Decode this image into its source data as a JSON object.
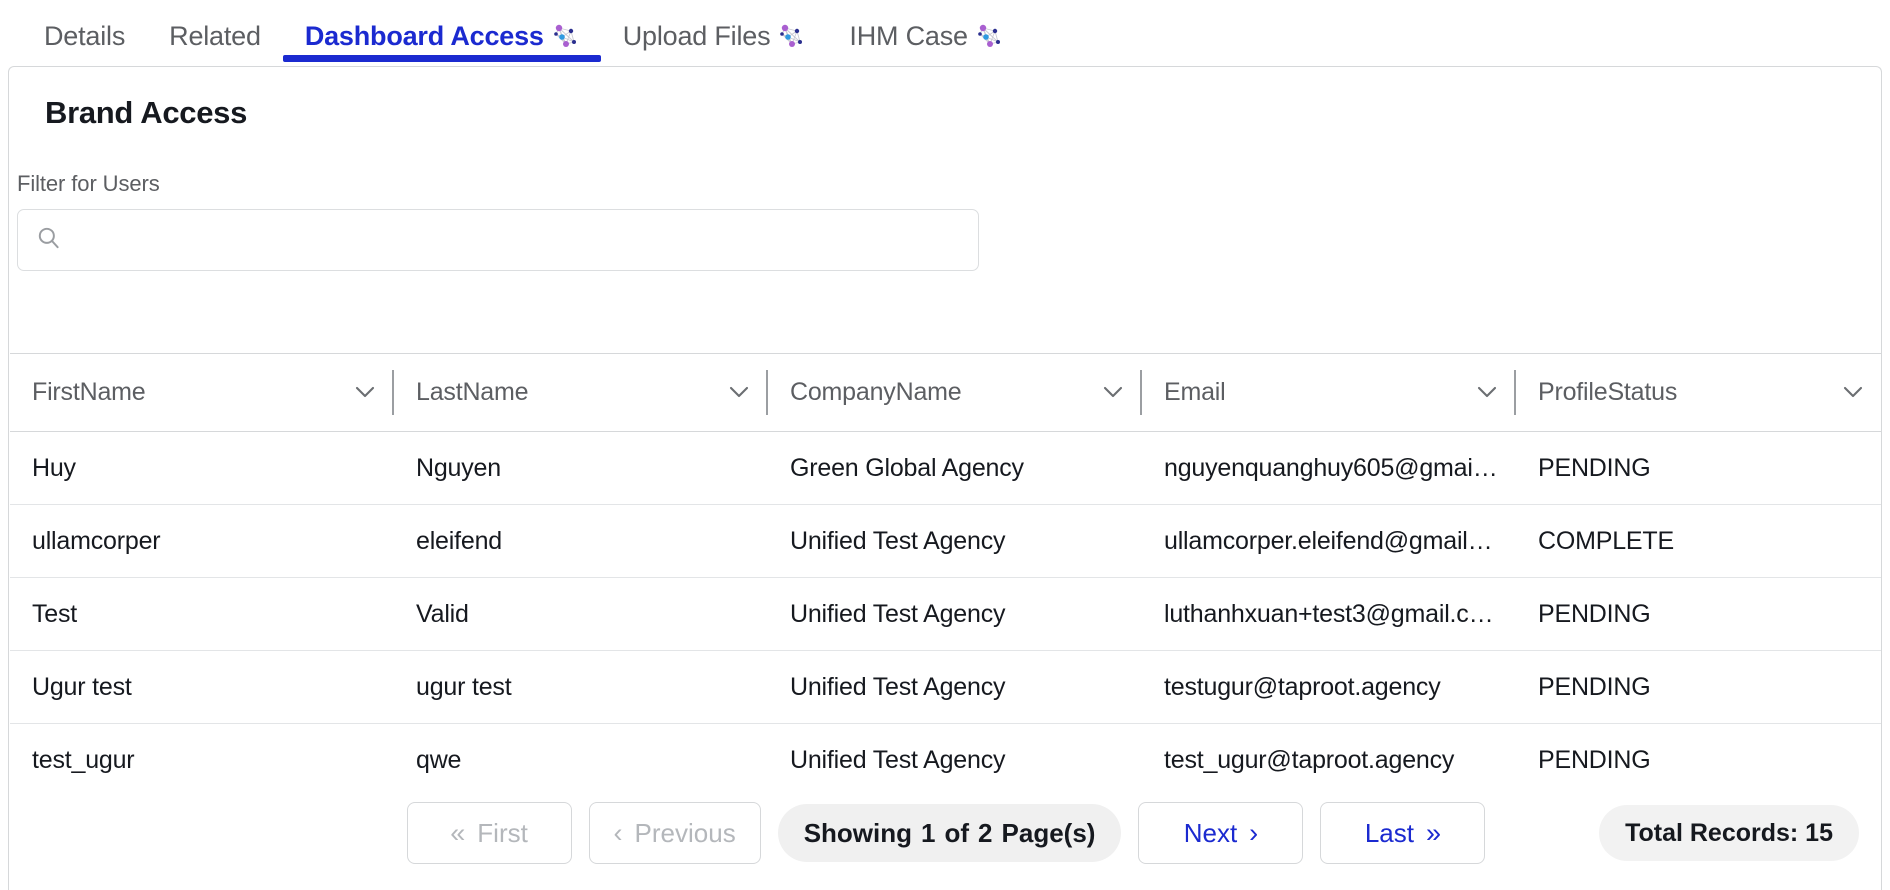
{
  "tabs": [
    {
      "label": "Details",
      "active": false,
      "icon": null
    },
    {
      "label": "Related",
      "active": false,
      "icon": null
    },
    {
      "label": "Dashboard Access",
      "active": true,
      "icon": "network-graph-icon"
    },
    {
      "label": "Upload Files",
      "active": false,
      "icon": "network-graph-icon"
    },
    {
      "label": "IHM Case",
      "active": false,
      "icon": "network-graph-icon"
    }
  ],
  "card": {
    "title": "Brand Access",
    "filter_label": "Filter for Users",
    "search": {
      "value": "",
      "placeholder": "",
      "icon": "search-icon"
    }
  },
  "table": {
    "columns": [
      {
        "label": "FirstName",
        "icon": "chevron-down-icon"
      },
      {
        "label": "LastName",
        "icon": "chevron-down-icon"
      },
      {
        "label": "CompanyName",
        "icon": "chevron-down-icon"
      },
      {
        "label": "Email",
        "icon": "chevron-down-icon"
      },
      {
        "label": "ProfileStatus",
        "icon": "chevron-down-icon"
      }
    ],
    "rows": [
      {
        "FirstName": "Huy",
        "LastName": "Nguyen",
        "CompanyName": "Green Global Agency",
        "Email": "nguyenquanghuy605@gmai…",
        "ProfileStatus": "PENDING"
      },
      {
        "FirstName": "ullamcorper",
        "LastName": "eleifend",
        "CompanyName": "Unified Test Agency",
        "Email": "ullamcorper.eleifend@gmail…",
        "ProfileStatus": "COMPLETE"
      },
      {
        "FirstName": "Test",
        "LastName": "Valid",
        "CompanyName": "Unified Test Agency",
        "Email": "luthanhxuan+test3@gmail.c…",
        "ProfileStatus": "PENDING"
      },
      {
        "FirstName": "Ugur test",
        "LastName": "ugur test",
        "CompanyName": "Unified Test Agency",
        "Email": "testugur@taproot.agency",
        "ProfileStatus": "PENDING"
      },
      {
        "FirstName": "test_ugur",
        "LastName": "qwe",
        "CompanyName": "Unified Test Agency",
        "Email": "test_ugur@taproot.agency",
        "ProfileStatus": "PENDING"
      }
    ]
  },
  "pagination": {
    "first_label": "First",
    "first_glyph": "«",
    "first_disabled": true,
    "previous_label": "Previous",
    "previous_glyph": "‹",
    "previous_disabled": true,
    "showing_prefix": "Showing",
    "current_page": "1",
    "of_text": "of",
    "total_pages": "2",
    "pages_suffix": "Page(s)",
    "next_label": "Next",
    "next_glyph": "›",
    "last_label": "Last",
    "last_glyph": "»",
    "total_records": "Total Records: 15"
  },
  "colors": {
    "accent": "#1b2ad0",
    "text": "#16191f",
    "muted": "#5c5e62",
    "disabled": "#b4b7bb",
    "border": "#d6d8da",
    "pill": "#f0f0f0"
  }
}
